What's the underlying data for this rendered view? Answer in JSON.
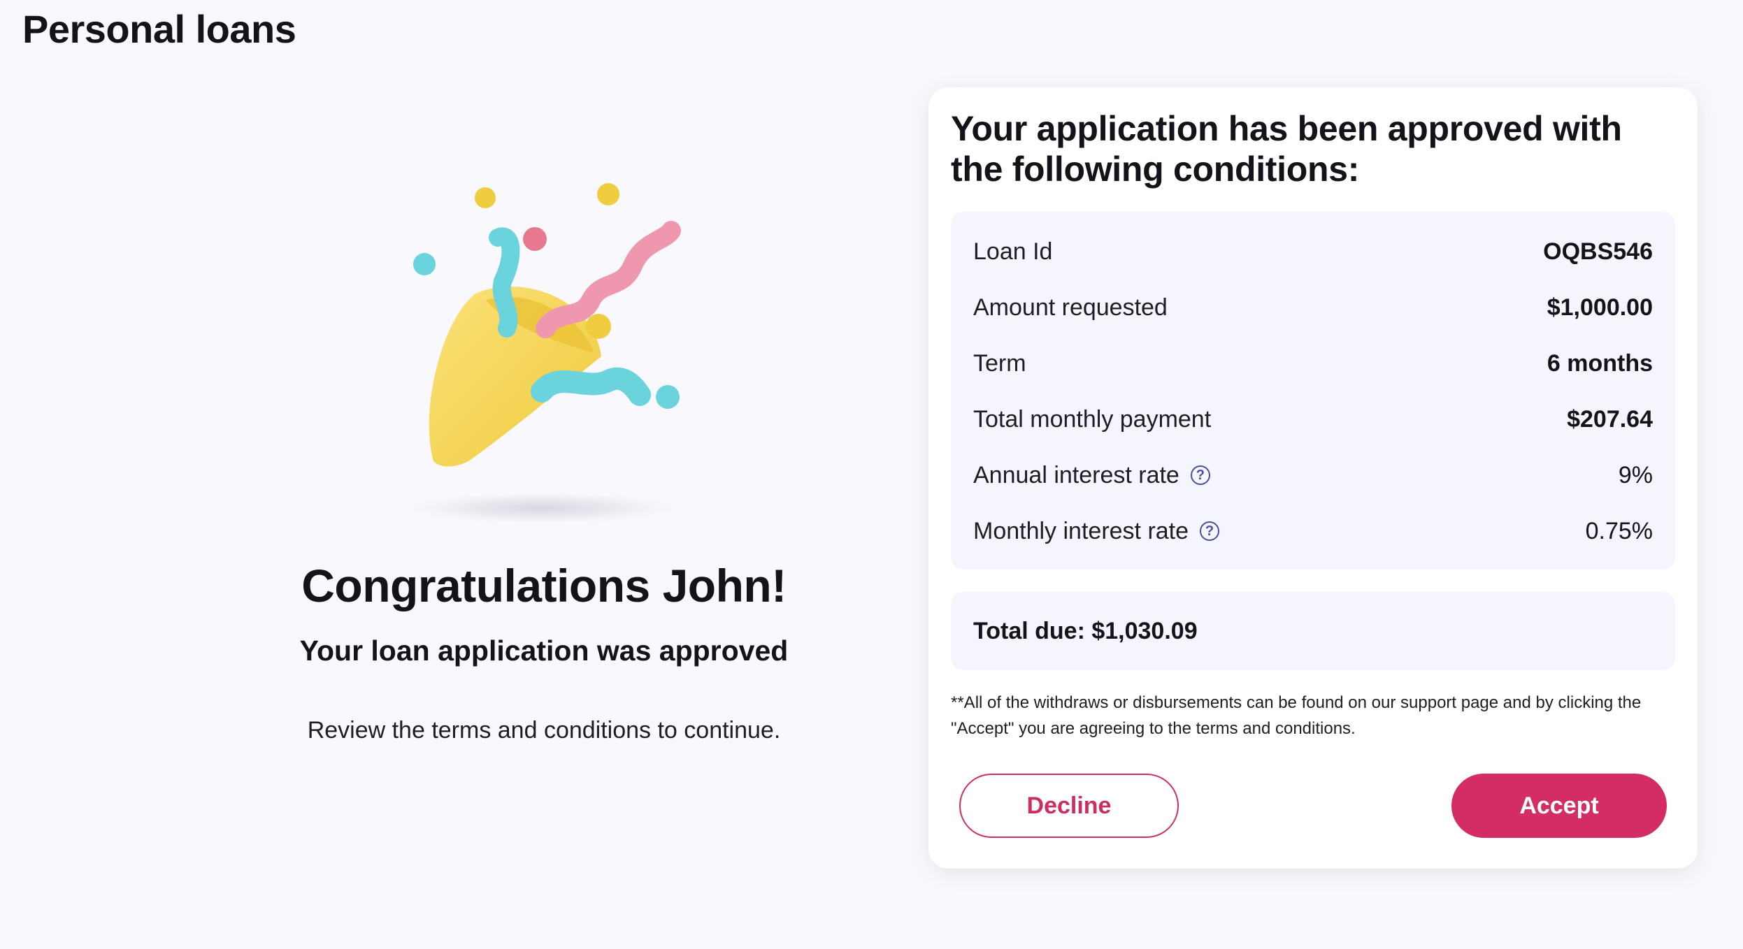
{
  "page": {
    "title": "Personal loans"
  },
  "left_panel": {
    "illustration_icon": "party-popper-icon",
    "congrats": "Congratulations John!",
    "subtitle": "Your loan application was approved",
    "instruction": "Review the terms and conditions to continue."
  },
  "card": {
    "heading": "Your application has been approved with the following conditions:",
    "rows": [
      {
        "label": "Loan Id",
        "value": "OQBS546"
      },
      {
        "label": "Amount requested",
        "value": "$1,000.00"
      },
      {
        "label": "Term",
        "value": "6 months"
      },
      {
        "label": "Total monthly payment",
        "value": "$207.64"
      },
      {
        "label": "Annual interest rate",
        "value": "9%",
        "help_icon": "question-circle-icon"
      },
      {
        "label": "Monthly interest rate",
        "value": "0.75%",
        "help_icon": "question-circle-icon"
      }
    ],
    "total_due": "Total due: $1,030.09",
    "disclaimer": "**All of the withdraws or disbursements can be found on our support page and by clicking the \"Accept\" you are agreeing to the terms and conditions.",
    "decline_label": "Decline",
    "accept_label": "Accept"
  },
  "colors": {
    "accent": "#d42d64",
    "background": "#f9f9fd",
    "panel": "#f5f6fd",
    "help_icon": "#4a4fa0"
  }
}
